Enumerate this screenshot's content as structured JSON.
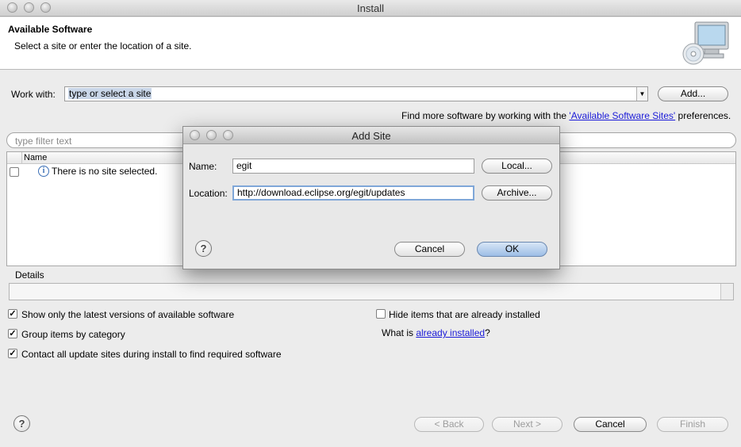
{
  "window": {
    "title": "Install"
  },
  "header": {
    "title": "Available Software",
    "subtitle": "Select a site or enter the location of a site."
  },
  "work_with": {
    "label": "Work with:",
    "value": "type or select a site",
    "add_button": "Add..."
  },
  "find_more": {
    "prefix": "Find more software by working with the ",
    "link": "'Available Software Sites'",
    "suffix": " preferences."
  },
  "filter": {
    "placeholder": "type filter text"
  },
  "table": {
    "column_name": "Name",
    "empty_message": "There is no site selected."
  },
  "details": {
    "label": "Details"
  },
  "options": {
    "show_latest": "Show only the latest versions of available software",
    "group_by_category": "Group items by category",
    "contact_all": "Contact all update sites during install to find required software",
    "hide_installed": "Hide items that are already installed",
    "what_is_prefix": "What is ",
    "what_is_link": "already installed",
    "what_is_suffix": "?"
  },
  "footer": {
    "back": "< Back",
    "next": "Next >",
    "cancel": "Cancel",
    "finish": "Finish"
  },
  "add_site_dialog": {
    "title": "Add Site",
    "name_label": "Name:",
    "name_value": "egit",
    "location_label": "Location:",
    "location_value": "http://download.eclipse.org/egit/updates",
    "local_button": "Local...",
    "archive_button": "Archive...",
    "cancel_button": "Cancel",
    "ok_button": "OK"
  }
}
